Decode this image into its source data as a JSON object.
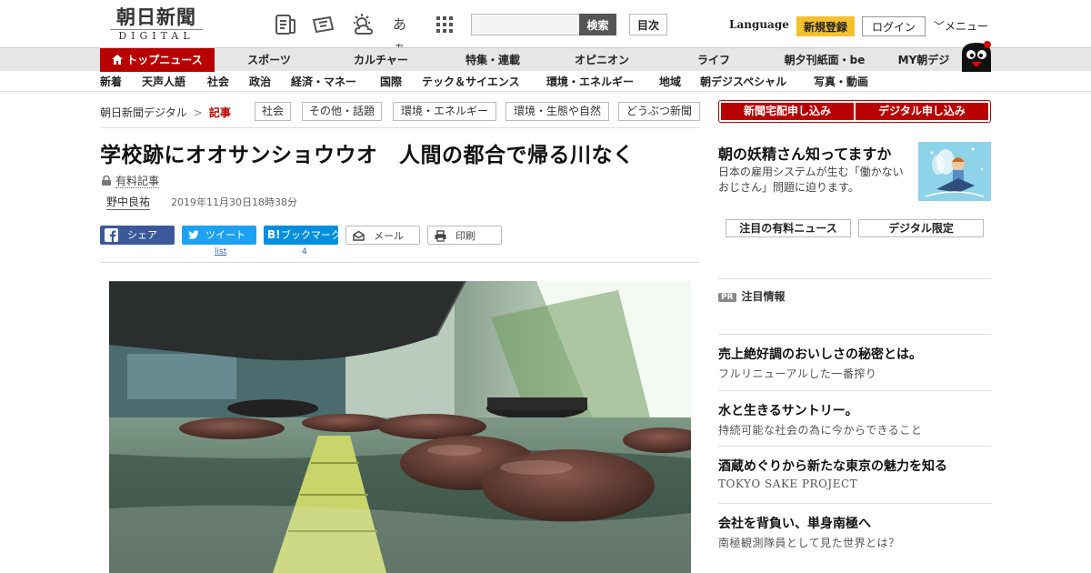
{
  "header": {
    "logo_kanji": "朝日新聞",
    "logo_sub": "DIGITAL",
    "search_placeholder": "",
    "search_label": "検索",
    "toc_label": "目次",
    "language_label": "Language",
    "register_label": "新規登録",
    "login_label": "ログイン",
    "menu_label": "メニュー",
    "font_icon_text": "あぁ"
  },
  "nav_primary": [
    "トップニュース",
    "スポーツ",
    "カルチャー",
    "特集・連載",
    "オピニオン",
    "ライフ",
    "朝夕刊紙面・be",
    "MY朝デジ"
  ],
  "nav_secondary": [
    "新着",
    "天声人語",
    "社会",
    "政治",
    "経済・マネー",
    "国際",
    "テック＆サイエンス",
    "環境・エネルギー",
    "地域",
    "朝デジスペシャル",
    "写真・動画"
  ],
  "breadcrumb": {
    "home": "朝日新聞デジタル",
    "sep": ">",
    "current": "記事"
  },
  "tags": [
    "社会",
    "その他・話題",
    "環境・エネルギー",
    "環境・生態や自然",
    "どうぶつ新聞"
  ],
  "article": {
    "title": "学校跡にオオサンショウウオ　人間の都合で帰る川なく",
    "paid_label": "有料記事",
    "author": "野中良祐",
    "timestamp": "2019年11月30日18時38分"
  },
  "share": {
    "facebook": "シェア",
    "twitter": "ツイート",
    "hatena": "ブックマーク",
    "mail": "メール",
    "print": "印刷",
    "twitter_count": "list",
    "hatena_count": "4"
  },
  "sidebar": {
    "subscribe_paper": "新聞宅配申し込み",
    "subscribe_digital": "デジタル申し込み",
    "promo_title": "朝の妖精さん知ってますか",
    "promo_desc": "日本の雇用システムが生む「働かないおじさん」問題に迫ります。",
    "tab_paid_news": "注目の有料ニュース",
    "tab_digital_only": "デジタル限定",
    "pr_badge": "PR",
    "pr_header": "注目情報",
    "pr_items": [
      {
        "title": "売上絶好調のおいしさの秘密とは。",
        "desc": "フルリニューアルした一番搾り"
      },
      {
        "title": "水と生きるサントリー。",
        "desc": "持続可能な社会の為に今からできること"
      },
      {
        "title": "酒蔵めぐりから新たな東京の魅力を知る",
        "desc": "TOKYO SAKE PROJECT"
      },
      {
        "title": "会社を背負い、単身南極へ",
        "desc": "南極観測隊員として見た世界とは？"
      }
    ]
  },
  "colors": {
    "brand_red": "#b80000",
    "accent_yellow": "#f6c12f",
    "nav_gray": "#e6e6e6"
  }
}
